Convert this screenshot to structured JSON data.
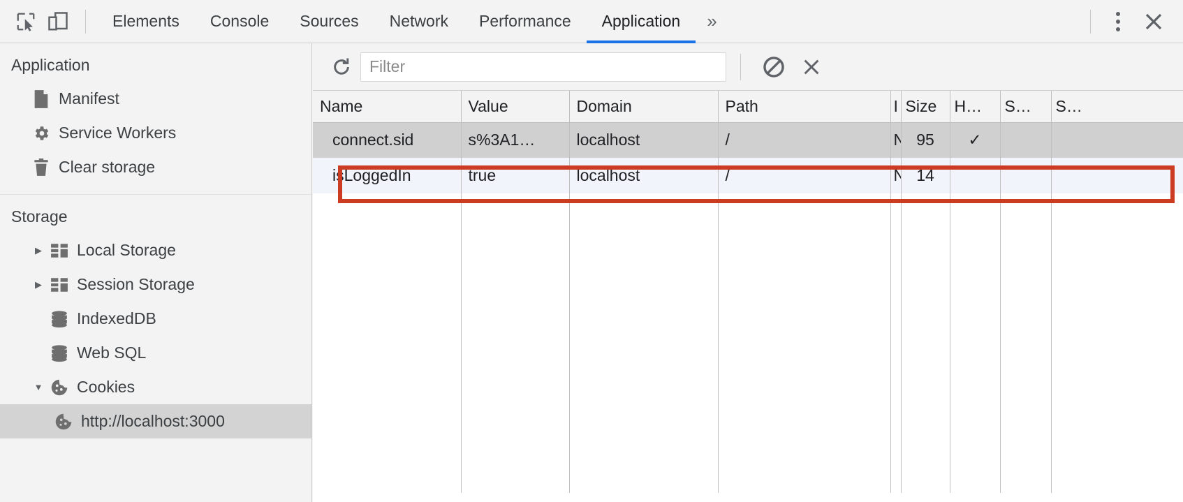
{
  "toolbar": {
    "inspect_icon": "inspect-element-icon",
    "device_icon": "device-toolbar-icon",
    "more_tabs_label": "»",
    "menu_icon": "kebab-menu-icon",
    "close_icon": "close-icon",
    "tabs": [
      {
        "label": "Elements",
        "active": false
      },
      {
        "label": "Console",
        "active": false
      },
      {
        "label": "Sources",
        "active": false
      },
      {
        "label": "Network",
        "active": false
      },
      {
        "label": "Performance",
        "active": false
      },
      {
        "label": "Application",
        "active": true
      }
    ],
    "active_tab_underline_color": "#1a73e8"
  },
  "sidebar": {
    "application_section": {
      "title": "Application",
      "items": [
        {
          "label": "Manifest",
          "icon": "document-icon"
        },
        {
          "label": "Service Workers",
          "icon": "gear-icon"
        },
        {
          "label": "Clear storage",
          "icon": "trash-icon"
        }
      ]
    },
    "storage_section": {
      "title": "Storage",
      "items": [
        {
          "label": "Local Storage",
          "icon": "table-icon",
          "twisty": "▶",
          "expanded": false,
          "selected": false
        },
        {
          "label": "Session Storage",
          "icon": "table-icon",
          "twisty": "▶",
          "expanded": false,
          "selected": false
        },
        {
          "label": "IndexedDB",
          "icon": "database-icon",
          "twisty": "",
          "expanded": false,
          "selected": false
        },
        {
          "label": "Web SQL",
          "icon": "database-icon",
          "twisty": "",
          "expanded": false,
          "selected": false
        },
        {
          "label": "Cookies",
          "icon": "cookie-icon",
          "twisty": "▼",
          "expanded": true,
          "selected": false
        }
      ],
      "cookie_origins": [
        {
          "label": "http://localhost:3000",
          "icon": "cookie-icon",
          "selected": true
        }
      ]
    }
  },
  "filterbar": {
    "refresh_icon": "refresh-icon",
    "filter_placeholder": "Filter",
    "filter_value": "",
    "clear_all_icon": "clear-all-cookies-icon",
    "delete_icon": "delete-selected-cookie-icon"
  },
  "cookies_table": {
    "columns": [
      "Name",
      "Value",
      "Domain",
      "Path",
      "I",
      "Size",
      "H…",
      "S…",
      "S…"
    ],
    "rows": [
      {
        "name": "connect.sid",
        "value": "s%3A1…",
        "domain": "localhost",
        "path": "/",
        "expires": "N",
        "size": "95",
        "httponly": "✓",
        "secure": "",
        "samesite": "",
        "selected": true,
        "highlighted": false
      },
      {
        "name": "isLoggedIn",
        "value": "true",
        "domain": "localhost",
        "path": "/",
        "expires": "N",
        "size": "14",
        "httponly": "",
        "secure": "",
        "samesite": "",
        "selected": false,
        "highlighted": true
      }
    ]
  },
  "annotation": {
    "highlight_color": "#cc3c22",
    "target_row": "isLoggedIn"
  }
}
